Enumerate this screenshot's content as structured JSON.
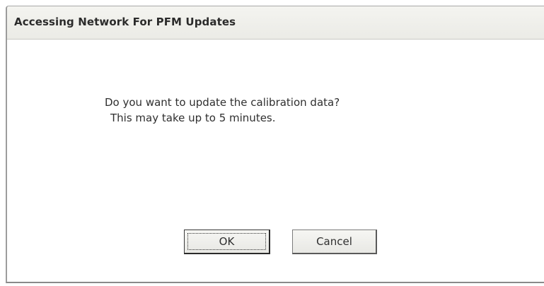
{
  "dialog": {
    "title": "Accessing Network For PFM Updates",
    "message_line1": "Do you want to update the calibration data?",
    "message_line2": "This may take up to 5 minutes.",
    "ok_label": "OK",
    "cancel_label": "Cancel"
  },
  "colors": {
    "titlebar_bg": "#efefea",
    "body_bg": "#ffffff",
    "text": "#2f2f2f"
  }
}
